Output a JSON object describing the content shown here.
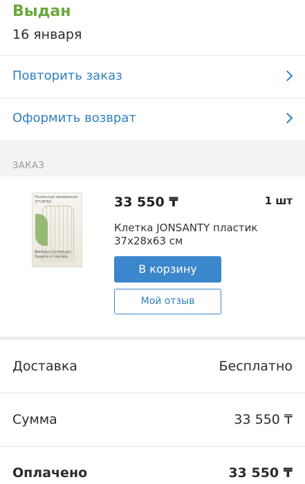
{
  "status": {
    "title": "Выдан",
    "date": "16 января"
  },
  "actions": [
    {
      "label": "Повторить заказ"
    },
    {
      "label": "Оформить возврат"
    }
  ],
  "order_section": {
    "header": "ЗАКАЗ"
  },
  "item": {
    "price": "33 550 ₸",
    "quantity": "1 шт",
    "title": "Клетка JONSANTY пластик 37x28x63 см",
    "image_caption_top": "Полностью панаренная 37*28*63",
    "image_caption_bottom": "Деревья коллекция Защита от мусора",
    "cart_button": "В корзину",
    "review_button": "Мой отзыв"
  },
  "summary": [
    {
      "label": "Доставка",
      "value": "Бесплатно"
    },
    {
      "label": "Сумма",
      "value": "33 550 ₸"
    },
    {
      "label": "Оплачено",
      "value": "33 550 ₸"
    }
  ],
  "colors": {
    "status_green": "#6aa83a",
    "link_blue": "#2f7fc1",
    "button_blue": "#3c86cc"
  }
}
